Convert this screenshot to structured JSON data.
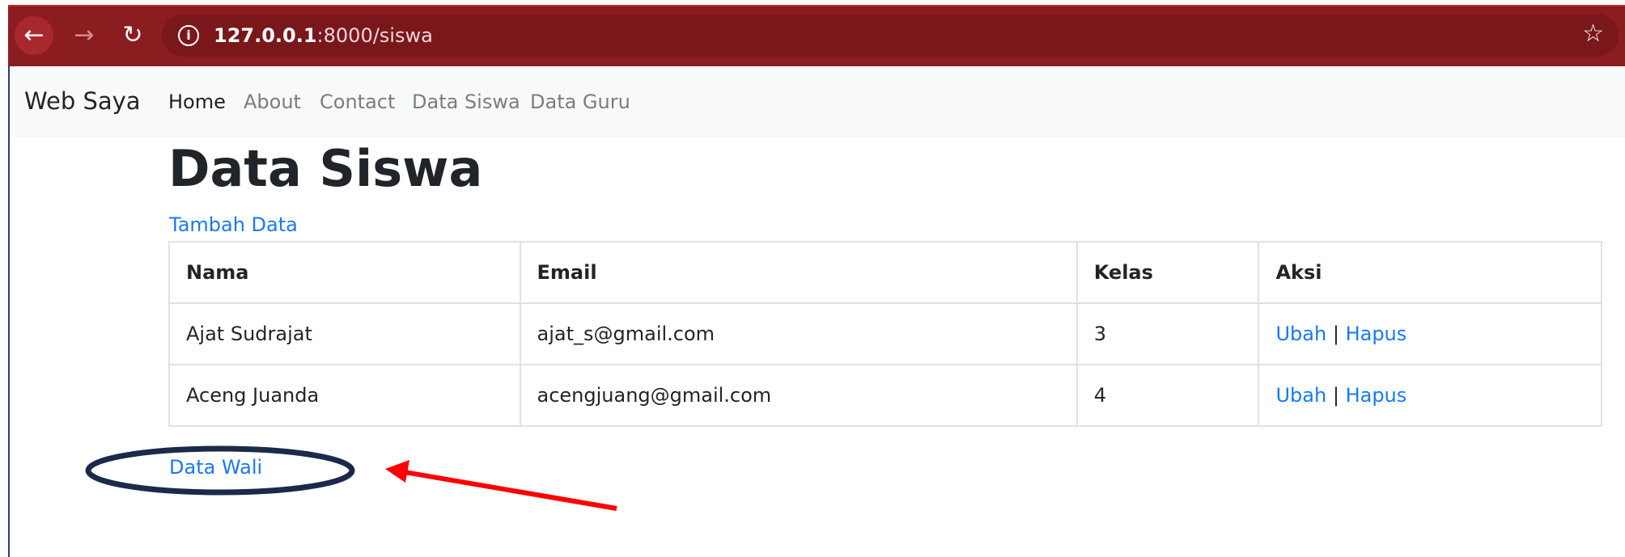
{
  "browser": {
    "url_host": "127.0.0.1",
    "url_rest": ":8000/siswa",
    "icons": [
      "back-arrow-icon",
      "forward-arrow-icon",
      "reload-icon",
      "info-icon",
      "star-icon"
    ]
  },
  "navbar": {
    "brand": "Web Saya",
    "items": [
      {
        "label": "Home",
        "active": true
      },
      {
        "label": "About"
      },
      {
        "label": "Contact"
      },
      {
        "label": "Data Siswa"
      },
      {
        "label": "Data Guru"
      }
    ]
  },
  "page": {
    "title": "Data Siswa",
    "add_link": "Tambah Data",
    "bottom_link": "Data Wali"
  },
  "table": {
    "headers": [
      "Nama",
      "Email",
      "Kelas",
      "Aksi"
    ],
    "rows": [
      {
        "nama": "Ajat Sudrajat",
        "email": "ajat_s@gmail.com",
        "kelas": "3",
        "edit": "Ubah",
        "sep": "|",
        "delete": "Hapus"
      },
      {
        "nama": "Aceng Juanda",
        "email": "acengjuang@gmail.com",
        "kelas": "4",
        "edit": "Ubah",
        "sep": "|",
        "delete": "Hapus"
      }
    ]
  },
  "colors": {
    "chrome": "#8b1c20",
    "link": "#1a78f2",
    "annotation_ellipse": "#1b2a4a",
    "annotation_arrow": "#ff0000"
  }
}
